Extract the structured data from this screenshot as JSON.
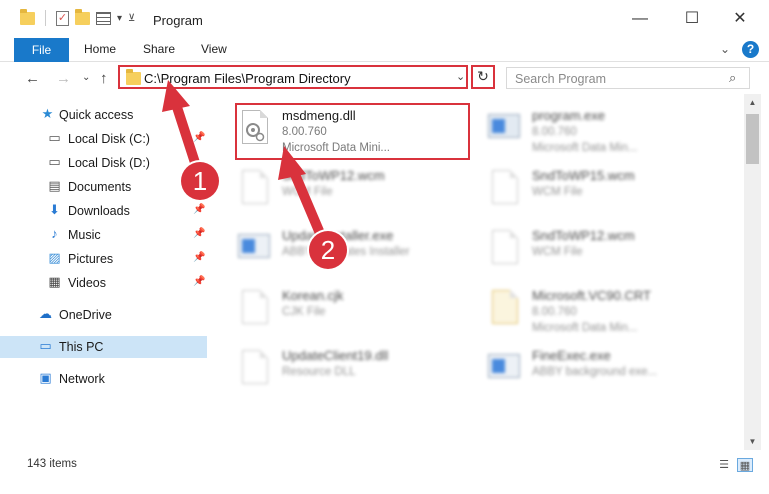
{
  "window": {
    "title": "Program",
    "minimize": "—",
    "maximize": "☐",
    "close": "✕"
  },
  "ribbon": {
    "file": "File",
    "home": "Home",
    "share": "Share",
    "view": "View",
    "help": "?"
  },
  "address": {
    "path": "C:\\Program Files\\Program Directory",
    "search_placeholder": "Search Program"
  },
  "sidebar": {
    "items": [
      {
        "label": "Quick access",
        "icon": "star-icon"
      },
      {
        "label": "Local Disk (C:)",
        "icon": "drive-icon",
        "pinned": true
      },
      {
        "label": "Local Disk (D:)",
        "icon": "drive-icon"
      },
      {
        "label": "Documents",
        "icon": "documents-icon",
        "pinned": true
      },
      {
        "label": "Downloads",
        "icon": "downloads-icon",
        "pinned": true
      },
      {
        "label": "Music",
        "icon": "music-icon",
        "pinned": true
      },
      {
        "label": "Pictures",
        "icon": "pictures-icon",
        "pinned": true
      },
      {
        "label": "Videos",
        "icon": "videos-icon",
        "pinned": true
      },
      {
        "label": "OneDrive",
        "icon": "cloud-icon"
      },
      {
        "label": "This PC",
        "icon": "computer-icon",
        "selected": true
      },
      {
        "label": "Network",
        "icon": "network-icon"
      }
    ]
  },
  "files": [
    {
      "name": "msdmeng.dll",
      "type": "8.00.760",
      "desc": "Microsoft Data Mini...",
      "icon": "dll-icon",
      "highlighted": true
    },
    {
      "name": "program.exe",
      "type": "8.00.760",
      "desc": "Microsoft Data Min...",
      "icon": "exe-icon"
    },
    {
      "name": "SndToWP12.wcm",
      "type": "WCM File",
      "desc": "",
      "icon": "file-icon"
    },
    {
      "name": "SndToWP15.wcm",
      "type": "WCM File",
      "desc": "",
      "icon": "file-icon"
    },
    {
      "name": "UpdateInstaller.exe",
      "type": "ABBYY Updates Installer",
      "desc": "",
      "icon": "app-icon"
    },
    {
      "name": "SndToWP12.wcm",
      "type": "WCM File",
      "desc": "",
      "icon": "file-icon"
    },
    {
      "name": "Korean.cjk",
      "type": "CJK File",
      "desc": "",
      "icon": "file-icon"
    },
    {
      "name": "Microsoft.VC90.CRT",
      "type": "8.00.760",
      "desc": "Microsoft Data Min...",
      "icon": "manifest-icon"
    },
    {
      "name": "UpdateClient19.dll",
      "type": "Resource DLL",
      "desc": "",
      "icon": "dll-icon"
    },
    {
      "name": "FineExec.exe",
      "type": "ABBY background exe...",
      "desc": "",
      "icon": "app-icon"
    }
  ],
  "status": {
    "item_count": "143 items"
  },
  "annotations": {
    "step1": "1",
    "step2": "2"
  }
}
